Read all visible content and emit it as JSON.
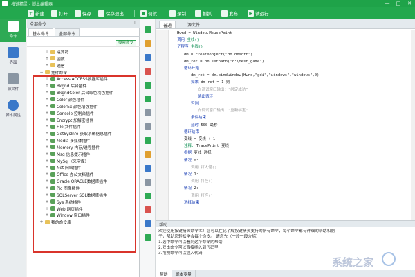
{
  "window": {
    "title": "按键精灵 - 脚本编辑器",
    "controls": [
      "—",
      "□",
      "✕"
    ]
  },
  "toolbar": {
    "items": [
      {
        "label": "新建",
        "icon": "new-icon"
      },
      {
        "label": "打开",
        "icon": "open-icon"
      },
      {
        "label": "保存",
        "icon": "save-icon"
      },
      {
        "label": "保存退出",
        "icon": "save-exit-icon"
      },
      {
        "label": "调试",
        "icon": "debug-icon"
      },
      {
        "label": "录制",
        "icon": "record-icon"
      },
      {
        "label": "抓抓",
        "icon": "capture-icon"
      },
      {
        "label": "发布",
        "icon": "publish-icon"
      },
      {
        "label": "试运行",
        "icon": "play-icon"
      }
    ]
  },
  "leftbar": {
    "items": [
      {
        "label": "命令",
        "active": true
      },
      {
        "label": "界面",
        "active": false
      },
      {
        "label": "源文件",
        "active": false
      },
      {
        "label": "脚本属性",
        "active": false
      }
    ]
  },
  "command_panel": {
    "header": "全部命令",
    "tabs": [
      "基本命令",
      "全部命令"
    ],
    "search_button": "搜索命令",
    "tree": [
      {
        "label": "运算符",
        "level": 1,
        "exp": "+",
        "icon": "folder"
      },
      {
        "label": "函数",
        "level": 1,
        "exp": "+",
        "icon": "folder"
      },
      {
        "label": "通信",
        "level": 1,
        "exp": "+",
        "icon": "folder"
      },
      {
        "label": "插件命令",
        "level": 0,
        "exp": "−",
        "icon": "folder"
      },
      {
        "label": "Access ACCESS数据库插件",
        "level": 1,
        "exp": "+",
        "icon": "plugin"
      },
      {
        "label": "Bkgnd 后台插件",
        "level": 1,
        "exp": "+",
        "icon": "plugin"
      },
      {
        "label": "BkgndColor 后台取色找色插件",
        "level": 1,
        "exp": "+",
        "icon": "plugin"
      },
      {
        "label": "Color 颜色插件",
        "level": 1,
        "exp": "+",
        "icon": "plugin"
      },
      {
        "label": "ColorEx 颜色增强插件",
        "level": 1,
        "exp": "+",
        "icon": "plugin"
      },
      {
        "label": "Console 控制台插件",
        "level": 1,
        "exp": "+",
        "icon": "plugin"
      },
      {
        "label": "Encrypt 加解密插件",
        "level": 1,
        "exp": "+",
        "icon": "plugin"
      },
      {
        "label": "File 文件插件",
        "level": 1,
        "exp": "+",
        "icon": "plugin"
      },
      {
        "label": "GetSysInfo 获取系统信息插件",
        "level": 1,
        "exp": "+",
        "icon": "plugin"
      },
      {
        "label": "Media 多媒体插件",
        "level": 1,
        "exp": "+",
        "icon": "plugin"
      },
      {
        "label": "Memory 内存/进程插件",
        "level": 1,
        "exp": "+",
        "icon": "plugin"
      },
      {
        "label": "Msg 信息提示插件",
        "level": 1,
        "exp": "+",
        "icon": "plugin"
      },
      {
        "label": "MySql（来宝库）",
        "level": 1,
        "exp": "+",
        "icon": "plugin"
      },
      {
        "label": "Net 网络插件",
        "level": 1,
        "exp": "+",
        "icon": "plugin"
      },
      {
        "label": "Office 办公文档插件",
        "level": 1,
        "exp": "+",
        "icon": "plugin"
      },
      {
        "label": "Oracle ORACLE数据库插件",
        "level": 1,
        "exp": "+",
        "icon": "plugin"
      },
      {
        "label": "Pic 图像插件",
        "level": 1,
        "exp": "+",
        "icon": "plugin"
      },
      {
        "label": "SQLServer SQL数据库插件",
        "level": 1,
        "exp": "+",
        "icon": "plugin"
      },
      {
        "label": "Sys 系统插件",
        "level": 1,
        "exp": "+",
        "icon": "plugin"
      },
      {
        "label": "Web 网页插件",
        "level": 1,
        "exp": "+",
        "icon": "plugin"
      },
      {
        "label": "Window 窗口插件",
        "level": 1,
        "exp": "+",
        "icon": "plugin"
      },
      {
        "label": "我的命令库",
        "level": 0,
        "exp": "+",
        "icon": "folder"
      }
    ]
  },
  "editor": {
    "tabs": [
      "普通",
      "源文件"
    ],
    "code_lines": [
      {
        "indent": 0,
        "parts": [
          [
            "s",
            "Hwnd = Window.MousePoint"
          ]
        ]
      },
      {
        "indent": 0,
        "parts": [
          [
            "k",
            "调用 "
          ],
          [
            "f",
            "主线()"
          ]
        ]
      },
      {
        "indent": 0,
        "parts": [
          [
            "k",
            "子程序 "
          ],
          [
            "f",
            "主线()"
          ]
        ]
      },
      {
        "indent": 1,
        "parts": [
          [
            "s",
            "dm = createobject(\"dm.dmsoft\")"
          ]
        ]
      },
      {
        "indent": 1,
        "parts": [
          [
            "s",
            "dm_ret = dm.setpath(\"c:\\test_game\")"
          ]
        ]
      },
      {
        "indent": 1,
        "parts": [
          [
            "k",
            "循环开始"
          ]
        ]
      },
      {
        "indent": 2,
        "parts": [
          [
            "s",
            "dm_ret = dm.bindwindow(Hwnd,\"gdi\",\"windows\",\"windows\",0)"
          ]
        ]
      },
      {
        "indent": 2,
        "parts": [
          [
            "k",
            "如果 "
          ],
          [
            "s",
            "dm_ret = 1 则"
          ]
        ]
      },
      {
        "indent": 3,
        "parts": [
          [
            "c",
            "向调试窗口输出：\"绑定成功\""
          ]
        ]
      },
      {
        "indent": 3,
        "parts": [
          [
            "k",
            "跳出循环"
          ]
        ]
      },
      {
        "indent": 2,
        "parts": [
          [
            "k",
            "否则"
          ]
        ]
      },
      {
        "indent": 3,
        "parts": [
          [
            "c",
            "向调试窗口输出：\"重新绑定\""
          ]
        ]
      },
      {
        "indent": 2,
        "parts": [
          [
            "k",
            "条件结束"
          ]
        ]
      },
      {
        "indent": 2,
        "parts": [
          [
            "k",
            "延时 "
          ],
          [
            "s",
            "500 毫秒"
          ]
        ]
      },
      {
        "indent": 1,
        "parts": [
          [
            "k",
            "循环结束"
          ]
        ]
      },
      {
        "indent": 1,
        "parts": [
          [
            "s",
            "变线 = 变线 + 1"
          ]
        ]
      },
      {
        "indent": 1,
        "parts": [
          [
            "f",
            "注释: "
          ],
          [
            "s",
            "TracePrint 变线"
          ]
        ]
      },
      {
        "indent": 1,
        "parts": [
          [
            "k",
            "根据 "
          ],
          [
            "s",
            "变线 选择"
          ]
        ]
      },
      {
        "indent": 1,
        "parts": [
          [
            "k",
            "情况 "
          ],
          [
            "s",
            "0:"
          ]
        ]
      },
      {
        "indent": 2,
        "parts": [
          [
            "c",
            "调用 打大怪()"
          ]
        ]
      },
      {
        "indent": 1,
        "parts": [
          [
            "k",
            "情况 "
          ],
          [
            "s",
            "1:"
          ]
        ]
      },
      {
        "indent": 2,
        "parts": [
          [
            "c",
            "调用 打怪()"
          ]
        ]
      },
      {
        "indent": 1,
        "parts": [
          [
            "k",
            "情况 "
          ],
          [
            "s",
            "2:"
          ]
        ]
      },
      {
        "indent": 2,
        "parts": [
          [
            "c",
            "调用 打怪()"
          ]
        ]
      },
      {
        "indent": 1,
        "parts": [
          [
            "k",
            "选择结束"
          ]
        ]
      }
    ]
  },
  "help": {
    "header": "帮助",
    "lines": [
      "欢迎使用按键精灵命令库！您可以在此了解按键精灵支持的所有命令，每个命令都有详细的帮助和例",
      "子，帮助您轻松学会每个命令。 请您先（一段一段介绍）",
      "1.选中命令可以看到这个命令的帮助",
      "2.双击命令可以直接插入到代码里",
      "3.拖拽命令可以插入代码"
    ],
    "bottom_tabs": [
      "帮助",
      "脚本变量"
    ]
  },
  "watermark": "系统之家"
}
